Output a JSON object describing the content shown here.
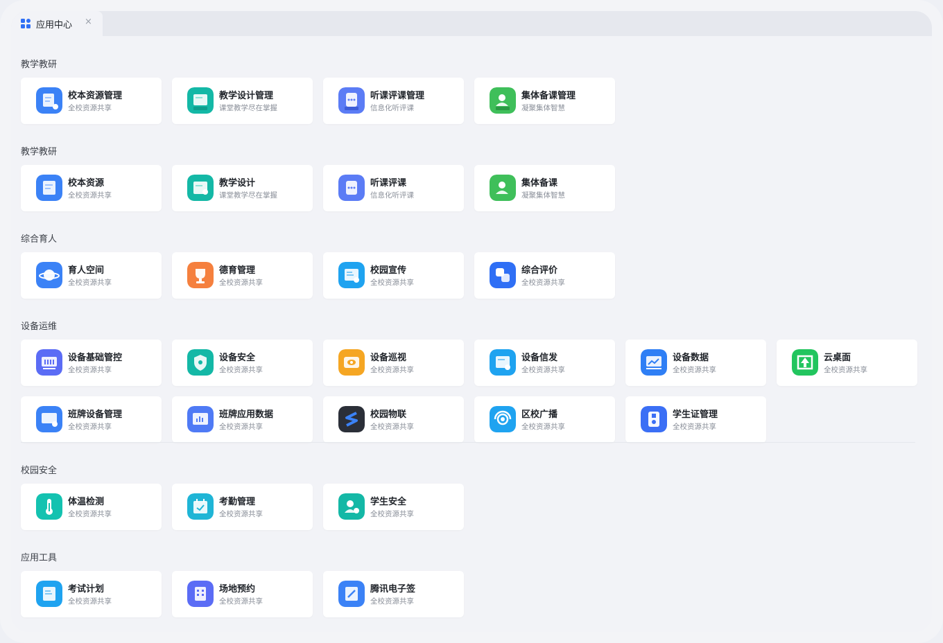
{
  "tab": {
    "label": "应用中心",
    "close": "×"
  },
  "sections": [
    {
      "title": "教学教研",
      "items": [
        {
          "name": "校本资源管理",
          "sub": "全校资源共享",
          "icon": "doc-manage-icon",
          "color": "#3b82f6"
        },
        {
          "name": "教学设计管理",
          "sub": "课堂教学尽在掌握",
          "icon": "design-manage-icon",
          "color": "#14b8a6"
        },
        {
          "name": "听课评课管理",
          "sub": "信息化听评课",
          "icon": "lesson-manage-icon",
          "color": "#5b7cf5"
        },
        {
          "name": "集体备课管理",
          "sub": "凝聚集体智慧",
          "icon": "group-prep-manage-icon",
          "color": "#3fbf5a"
        }
      ]
    },
    {
      "title": "教学教研",
      "items": [
        {
          "name": "校本资源",
          "sub": "全校资源共享",
          "icon": "doc-icon",
          "color": "#3b82f6"
        },
        {
          "name": "教学设计",
          "sub": "课堂教学尽在掌握",
          "icon": "design-icon",
          "color": "#14b8a6"
        },
        {
          "name": "听课评课",
          "sub": "信息化听评课",
          "icon": "lesson-icon",
          "color": "#5b7cf5"
        },
        {
          "name": "集体备课",
          "sub": "凝聚集体智慧",
          "icon": "group-prep-icon",
          "color": "#3fbf5a"
        }
      ]
    },
    {
      "title": "综合育人",
      "items": [
        {
          "name": "育人空间",
          "sub": "全校资源共享",
          "icon": "planet-icon",
          "color": "#3b82f6"
        },
        {
          "name": "德育管理",
          "sub": "全校资源共享",
          "icon": "trophy-icon",
          "color": "#f5803e"
        },
        {
          "name": "校园宣传",
          "sub": "全校资源共享",
          "icon": "campus-promo-icon",
          "color": "#1fa3f0"
        },
        {
          "name": "综合评价",
          "sub": "全校资源共享",
          "icon": "evaluation-icon",
          "color": "#2f6ff5"
        }
      ]
    },
    {
      "title": "设备运维",
      "items": [
        {
          "name": "设备基础管控",
          "sub": "全校资源共享",
          "icon": "device-control-icon",
          "color": "#5b6cf5"
        },
        {
          "name": "设备安全",
          "sub": "全校资源共享",
          "icon": "shield-icon",
          "color": "#14b8a6"
        },
        {
          "name": "设备巡视",
          "sub": "全校资源共享",
          "icon": "eye-icon",
          "color": "#f5a623"
        },
        {
          "name": "设备信发",
          "sub": "全校资源共享",
          "icon": "send-icon",
          "color": "#1fa3f0"
        },
        {
          "name": "设备数据",
          "sub": "全校资源共享",
          "icon": "device-data-icon",
          "color": "#2f7ff5"
        },
        {
          "name": "云桌面",
          "sub": "全校资源共享",
          "icon": "cloud-desktop-icon",
          "color": "#22c55e"
        },
        {
          "name": "班牌设备管理",
          "sub": "全校资源共享",
          "icon": "board-device-icon",
          "color": "#3b82f6"
        },
        {
          "name": "班牌应用数据",
          "sub": "全校资源共享",
          "icon": "board-data-icon",
          "color": "#4f7af5"
        },
        {
          "name": "校园物联",
          "sub": "全校资源共享",
          "icon": "iot-icon",
          "color": "#2b2f38"
        },
        {
          "name": "区校广播",
          "sub": "全校资源共享",
          "icon": "broadcast-icon",
          "color": "#1fa3f0"
        },
        {
          "name": "学生证管理",
          "sub": "全校资源共享",
          "icon": "student-card-icon",
          "color": "#3b6ff5"
        }
      ]
    },
    {
      "title": "校园安全",
      "items": [
        {
          "name": "体温检测",
          "sub": "全校资源共享",
          "icon": "thermometer-icon",
          "color": "#14c2b0"
        },
        {
          "name": "考勤管理",
          "sub": "全校资源共享",
          "icon": "calendar-check-icon",
          "color": "#1fb5d6"
        },
        {
          "name": "学生安全",
          "sub": "全校资源共享",
          "icon": "student-safe-icon",
          "color": "#14b8a6"
        }
      ]
    },
    {
      "title": "应用工具",
      "items": [
        {
          "name": "考试计划",
          "sub": "全校资源共享",
          "icon": "exam-plan-icon",
          "color": "#1fa3f0"
        },
        {
          "name": "场地预约",
          "sub": "全校资源共享",
          "icon": "building-icon",
          "color": "#5b6cf5"
        },
        {
          "name": "腾讯电子签",
          "sub": "全校资源共享",
          "icon": "e-sign-icon",
          "color": "#3b82f6"
        }
      ]
    }
  ]
}
